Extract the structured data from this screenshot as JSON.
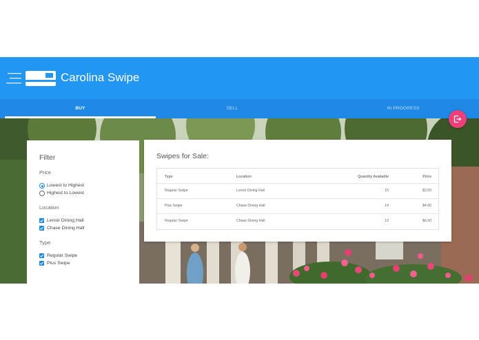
{
  "app": {
    "title": "Carolina Swipe",
    "colors": {
      "primary": "#2196f3",
      "tab_bar": "#1e88e5",
      "accent": "#ec407a"
    }
  },
  "tabs": [
    {
      "label": "BUY",
      "active": true
    },
    {
      "label": "SELL",
      "active": false
    },
    {
      "label": "IN PROGRESS",
      "active": false
    }
  ],
  "fab": {
    "icon": "logout-icon"
  },
  "filter": {
    "title": "Filter",
    "price": {
      "label": "Price",
      "options": [
        {
          "label": "Lowest to Highest",
          "selected": true
        },
        {
          "label": "Highest to Lowest",
          "selected": false
        }
      ]
    },
    "location": {
      "label": "Location",
      "options": [
        {
          "label": "Lenoir Dining Hall",
          "checked": true
        },
        {
          "label": "Chase Dining Hall",
          "checked": true
        }
      ]
    },
    "type": {
      "label": "Type",
      "options": [
        {
          "label": "Regular Swipe",
          "checked": true
        },
        {
          "label": "Plus Swipe",
          "checked": true
        }
      ]
    }
  },
  "listings": {
    "title": "Swipes for Sale:",
    "columns": [
      "Type",
      "Location",
      "Quantity Available",
      "Price"
    ],
    "rows": [
      [
        "Regular Swipe",
        "Lenoir Dining Hall",
        "15",
        "$3.50"
      ],
      [
        "Plus Swipe",
        "Chase Dining Hall",
        "14",
        "$4.00"
      ],
      [
        "Regular Swipe",
        "Chase Dining Hall",
        "12",
        "$6.50"
      ]
    ]
  }
}
